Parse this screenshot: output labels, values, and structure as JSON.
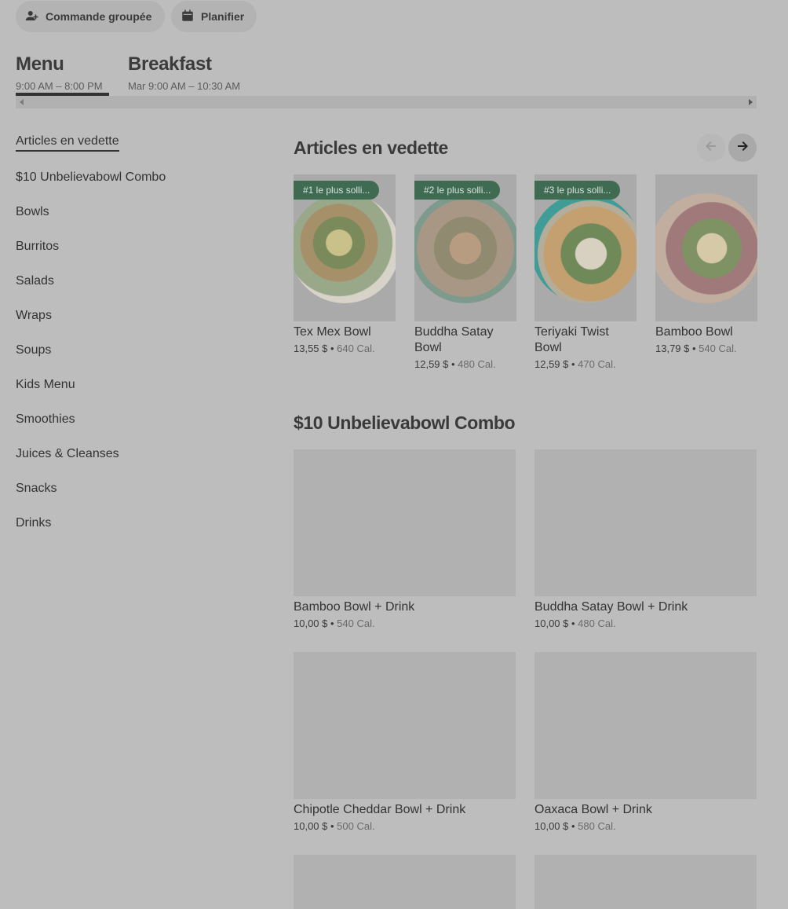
{
  "top_actions": {
    "group_order": "Commande groupée",
    "schedule": "Planifier"
  },
  "menu_tabs": [
    {
      "title": "Menu",
      "hours": "9:00 AM – 8:00 PM"
    },
    {
      "title": "Breakfast",
      "hours": "Mar 9:00 AM – 10:30 AM"
    }
  ],
  "sidebar": {
    "items": [
      "Articles en vedette",
      "$10 Unbelievabowl Combo",
      "Bowls",
      "Burritos",
      "Salads",
      "Wraps",
      "Soups",
      "Kids Menu",
      "Smoothies",
      "Juices & Cleanses",
      "Snacks",
      "Drinks"
    ]
  },
  "featured": {
    "title": "Articles en vedette",
    "items": [
      {
        "badge": "#1 le plus solli...",
        "name": "Tex Mex Bowl",
        "price": "13,55 $",
        "cal": "640 Cal."
      },
      {
        "badge": "#2 le plus solli...",
        "name": "Buddha Satay Bowl",
        "price": "12,59 $",
        "cal": "480 Cal."
      },
      {
        "badge": "#3 le plus solli...",
        "name": "Teriyaki Twist Bowl",
        "price": "12,59 $",
        "cal": "470 Cal."
      },
      {
        "badge": "",
        "name": "Bamboo Bowl",
        "price": "13,79 $",
        "cal": "540 Cal."
      }
    ]
  },
  "combo": {
    "title": "$10 Unbelievabowl Combo",
    "items": [
      {
        "name": "Bamboo Bowl + Drink",
        "price": "10,00 $",
        "cal": "540 Cal."
      },
      {
        "name": "Buddha Satay Bowl + Drink",
        "price": "10,00 $",
        "cal": "480 Cal."
      },
      {
        "name": "Chipotle Cheddar Bowl + Drink",
        "price": "10,00 $",
        "cal": "500 Cal."
      },
      {
        "name": "Oaxaca Bowl + Drink",
        "price": "10,00 $",
        "cal": "580 Cal."
      }
    ]
  },
  "colors": {
    "overlay_bg": "#bdbdbd",
    "badge_bg": "#3f6b52",
    "text_primary": "#333333"
  },
  "icons": {
    "group_order": "person-add-icon",
    "schedule": "calendar-icon",
    "prev": "arrow-left-icon",
    "next": "arrow-right-icon"
  }
}
